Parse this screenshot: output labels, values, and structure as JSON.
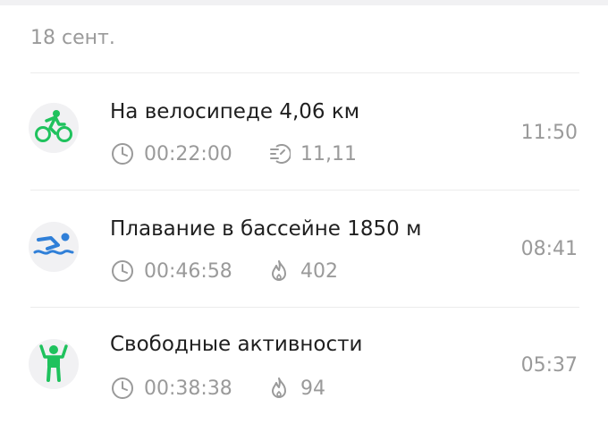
{
  "date_header": "18 сент.",
  "colors": {
    "accent": "#1fc25d",
    "swim": "#2f7fd8",
    "muted": "#9a9a9a",
    "avatar_bg": "#f1f1f3"
  },
  "activities": [
    {
      "icon": "cycling-icon",
      "title": "На велосипеде 4,06 км",
      "duration": "00:22:00",
      "stat_icon": "speedometer-icon",
      "stat_value": "11,11",
      "time": "11:50"
    },
    {
      "icon": "swimming-icon",
      "title": "Плавание в бассейне 1850 м",
      "duration": "00:46:58",
      "stat_icon": "flame-icon",
      "stat_value": "402",
      "time": "08:41"
    },
    {
      "icon": "free-activity-icon",
      "title": "Свободные активности",
      "duration": "00:38:38",
      "stat_icon": "flame-icon",
      "stat_value": "94",
      "time": "05:37"
    }
  ]
}
